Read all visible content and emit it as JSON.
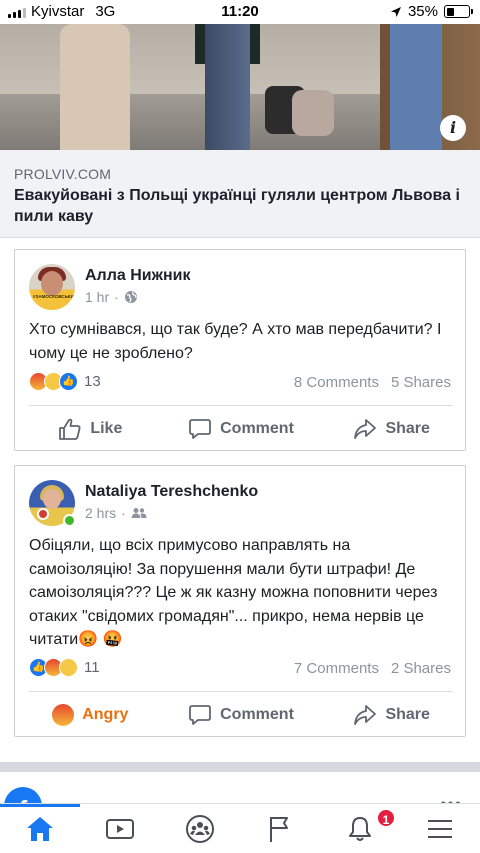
{
  "status_bar": {
    "carrier": "Kyivstar",
    "network": "3G",
    "time": "11:20",
    "battery": "35%",
    "battery_level": 0.35
  },
  "link_preview": {
    "domain": "PROLVIV.COM",
    "headline": "Евакуйовані з Польщі українці гуляли центром Львова і пили каву",
    "info_icon": "info-icon"
  },
  "comments": [
    {
      "author": "Алла Нижник",
      "time": "1 hr",
      "audience_icon": "globe-icon",
      "text": "Хто сумнівався, що так буде? А хто мав передбачити? І чому це не зроблено?",
      "reaction_count": "13",
      "reaction_icons": [
        "angry-icon",
        "wow-icon",
        "like-icon"
      ],
      "comments_count": "8 Comments",
      "shares_count": "5 Shares",
      "actions": {
        "like": "Like",
        "comment": "Comment",
        "share": "Share"
      }
    },
    {
      "author": "Nataliya Tereshchenko",
      "time": "2 hrs",
      "audience_icon": "friends-icon",
      "text": "Обіцяли, що всіх примусово направлять на самоізоляцію! За порушення мали бути штрафи! Де самоізоляція??? Це ж як казну можна поповнити через отаких \"свідомих громадян\"... прикро, нема нервів це читати😡 🤬",
      "reaction_count": "11",
      "reaction_icons": [
        "like-icon",
        "angry-icon",
        "wow-icon"
      ],
      "comments_count": "7 Comments",
      "shares_count": "2 Shares",
      "actions": {
        "like": "Angry",
        "comment": "Comment",
        "share": "Share"
      }
    }
  ],
  "tab_bar": {
    "notification_badge": "1",
    "tabs": [
      "home-icon",
      "watch-icon",
      "groups-icon",
      "pages-icon",
      "notifications-icon",
      "menu-icon"
    ]
  },
  "colors": {
    "brand_blue": "#1877f2",
    "angry_orange": "#e9710f",
    "badge_red": "#e41e3f"
  }
}
